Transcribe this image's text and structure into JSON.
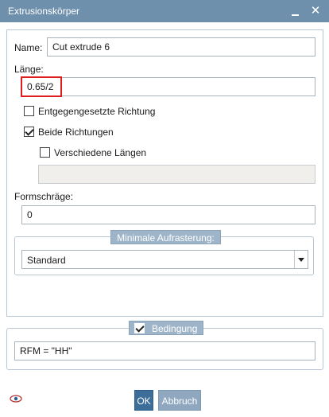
{
  "window": {
    "title": "Extrusionskörper"
  },
  "fields": {
    "name_label": "Name:",
    "name_value": "Cut extrude 6",
    "length_label": "Länge:",
    "length_value": "0.65/2",
    "opposite_direction": {
      "label": "Entgegengesetzte Richtung",
      "checked": false
    },
    "both_directions": {
      "label": "Beide Richtungen",
      "checked": true
    },
    "different_lengths": {
      "label": "Verschiedene Längen",
      "checked": false
    },
    "draft_label": "Formschräge:",
    "draft_value": "0"
  },
  "min_tessellation": {
    "legend": "Minimale Aufrasterung:",
    "selected": "Standard"
  },
  "condition": {
    "legend": "Bedingung",
    "checked": true,
    "value": "RFM = \"HH\""
  },
  "buttons": {
    "ok": "OK",
    "cancel": "Abbruch"
  },
  "icons": {
    "visibility": "eye-icon",
    "minimize": "minimize-icon",
    "close": "close-icon"
  },
  "colors": {
    "titlebar": "#6f90ad",
    "highlight": "#e01d1d",
    "legend": "#9eb4c8",
    "ok_button": "#3c6e99"
  }
}
